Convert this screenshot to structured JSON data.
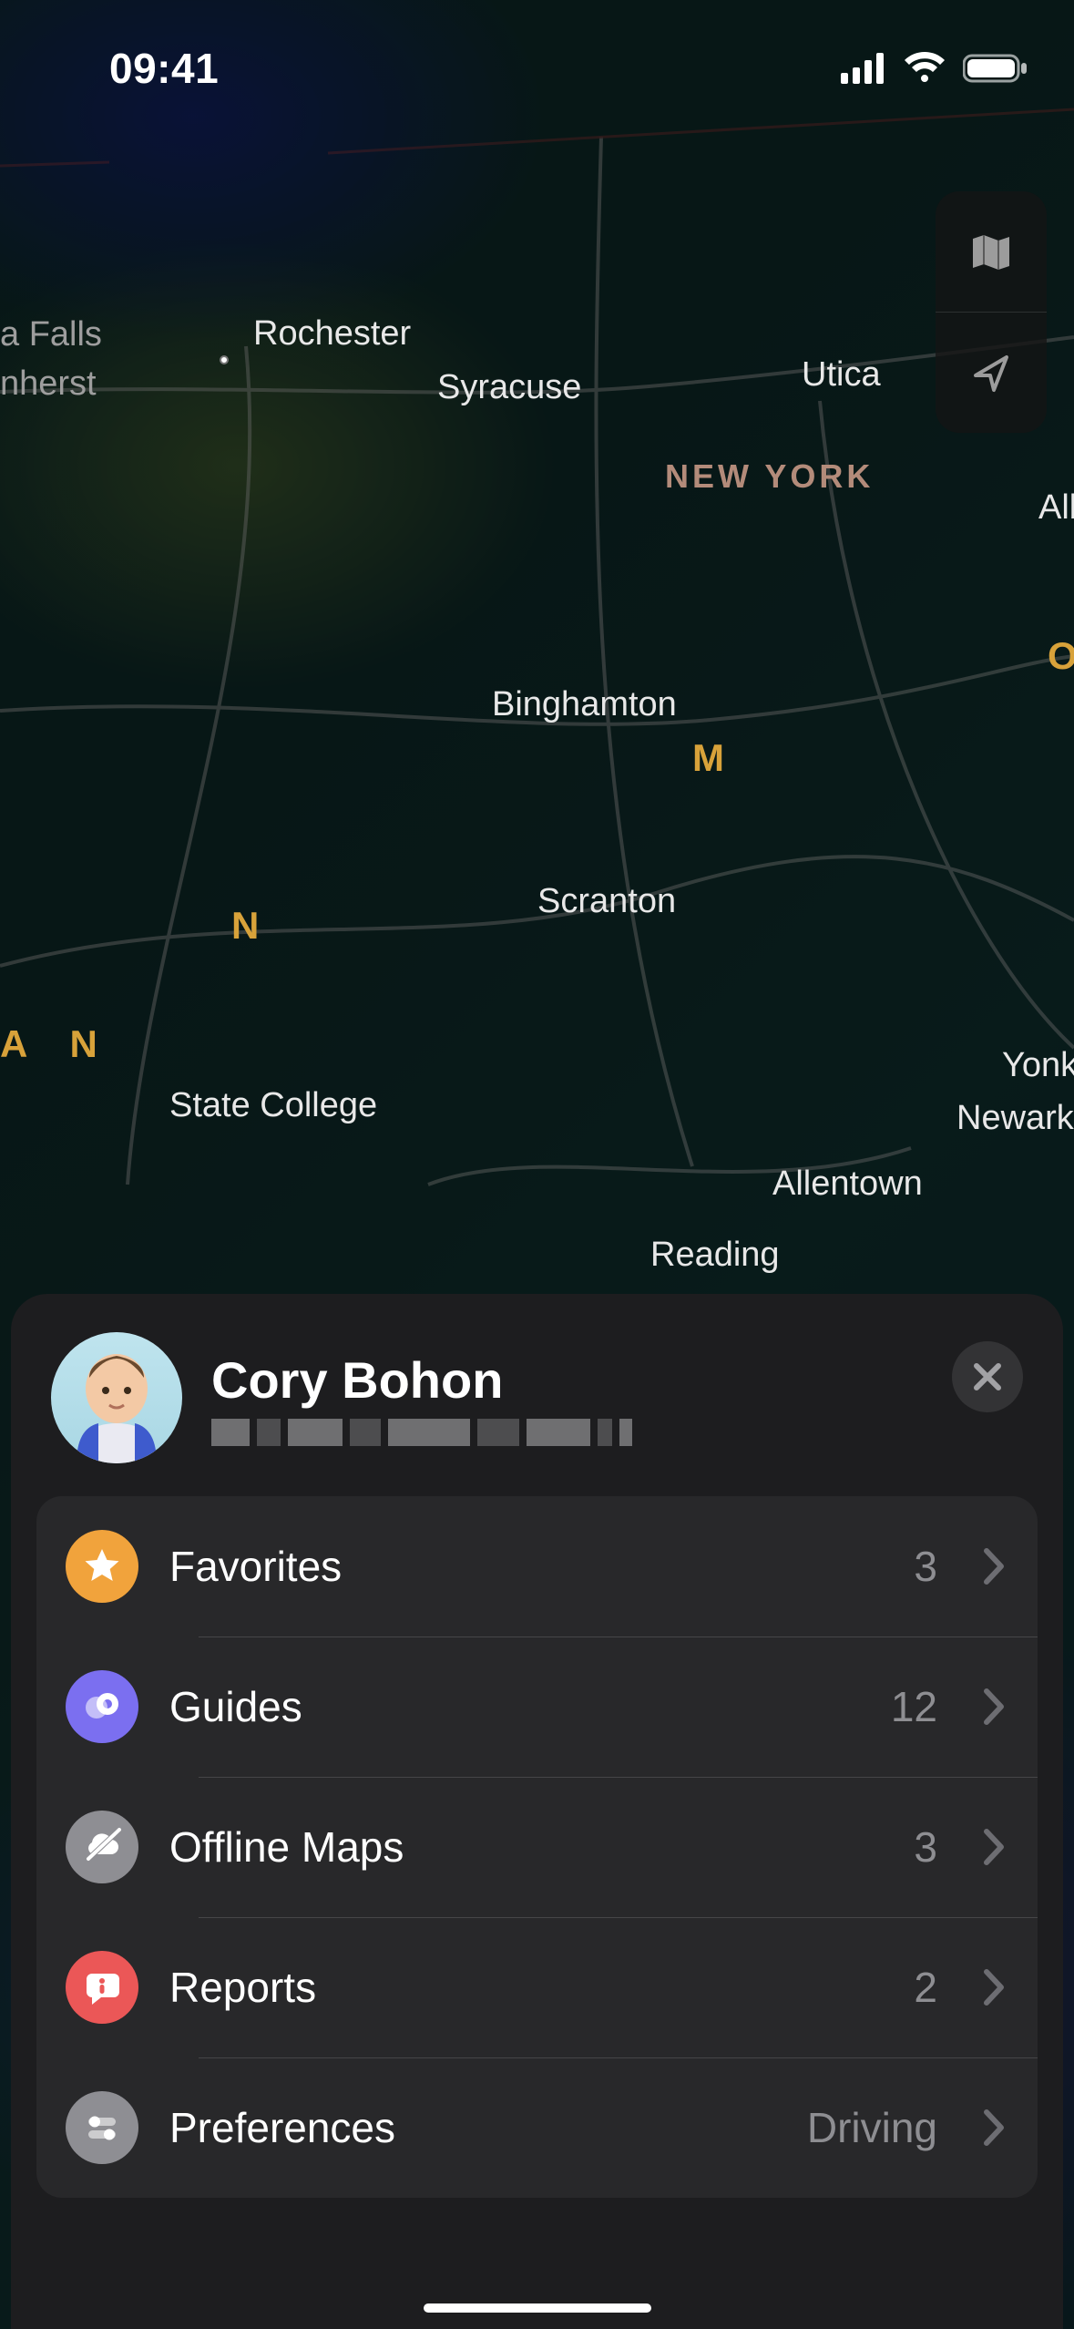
{
  "status": {
    "time": "09:41"
  },
  "map": {
    "region_label": "NEW YORK",
    "cities": {
      "rochester": "Rochester",
      "syracuse": "Syracuse",
      "utica": "Utica",
      "binghamton": "Binghamton",
      "scranton": "Scranton",
      "state_college": "State College",
      "allentown": "Allentown",
      "reading": "Reading",
      "newark": "Newark",
      "yonkers": "Yonk",
      "albany": "Alb",
      "falls": "a Falls",
      "amherst": "nherst"
    },
    "road_letters": {
      "o": "O",
      "m": "M",
      "n": "N",
      "an": "A   N"
    }
  },
  "sheet": {
    "user_name": "Cory Bohon",
    "rows": {
      "favorites": {
        "label": "Favorites",
        "value": "3"
      },
      "guides": {
        "label": "Guides",
        "value": "12"
      },
      "offline_maps": {
        "label": "Offline Maps",
        "value": "3"
      },
      "reports": {
        "label": "Reports",
        "value": "2"
      },
      "preferences": {
        "label": "Preferences",
        "value": "Driving"
      }
    }
  }
}
